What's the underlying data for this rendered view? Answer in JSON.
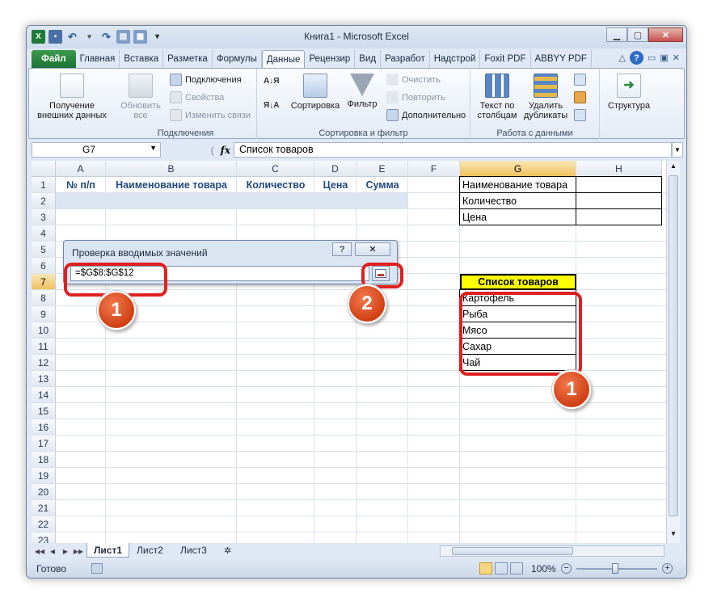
{
  "window": {
    "title": "Книга1  -  Microsoft Excel"
  },
  "ribbon_tabs": [
    "Файл",
    "Главная",
    "Вставка",
    "Разметка",
    "Формулы",
    "Данные",
    "Рецензир",
    "Вид",
    "Разработ",
    "Надстрой",
    "Foxit PDF",
    "ABBYY PDF"
  ],
  "active_tab": "Данные",
  "ribbon": {
    "get_external_data": "Получение внешних данных",
    "refresh_all": "Обновить все",
    "connections": "Подключения",
    "properties": "Свойства",
    "edit_links": "Изменить связи",
    "group_connections": "Подключения",
    "sort": "Сортировка",
    "filter": "Фильтр",
    "clear": "Очистить",
    "reapply": "Повторить",
    "advanced": "Дополнительно",
    "group_sort_filter": "Сортировка и фильтр",
    "text_to_columns": "Текст по столбцам",
    "remove_duplicates": "Удалить дубликаты",
    "group_data_tools": "Работа с данными",
    "outline": "Структура"
  },
  "formula_bar": {
    "name_box": "G7",
    "fx": "fx",
    "formula": "Список товаров"
  },
  "columns": [
    "A",
    "B",
    "C",
    "D",
    "E",
    "F",
    "G",
    "H"
  ],
  "rows": [
    "1",
    "2",
    "3",
    "4",
    "5",
    "6",
    "7",
    "8",
    "9",
    "10",
    "11",
    "12",
    "13",
    "14",
    "15",
    "16",
    "17",
    "18",
    "19",
    "20",
    "21",
    "22",
    "23"
  ],
  "table_headers": [
    "№ п/п",
    "Наименование товара",
    "Количество",
    "Цена",
    "Сумма"
  ],
  "side_table": [
    "Наименование товара",
    "Количество",
    "Цена"
  ],
  "list_title": "Список товаров",
  "list_items": [
    "Картофель",
    "Рыба",
    "Мясо",
    "Сахар",
    "Чай"
  ],
  "dialog": {
    "title": "Проверка вводимых значений",
    "help": "?",
    "close": "✕",
    "value": "=$G$8:$G$12"
  },
  "badges": [
    "1",
    "2",
    "1"
  ],
  "sheets": [
    "Лист1",
    "Лист2",
    "Лист3"
  ],
  "status": {
    "ready": "Готово",
    "zoom": "100%"
  },
  "colors": {
    "accent": "#1d7233",
    "highlight": "#ffff00",
    "annotation": "#e02020"
  }
}
